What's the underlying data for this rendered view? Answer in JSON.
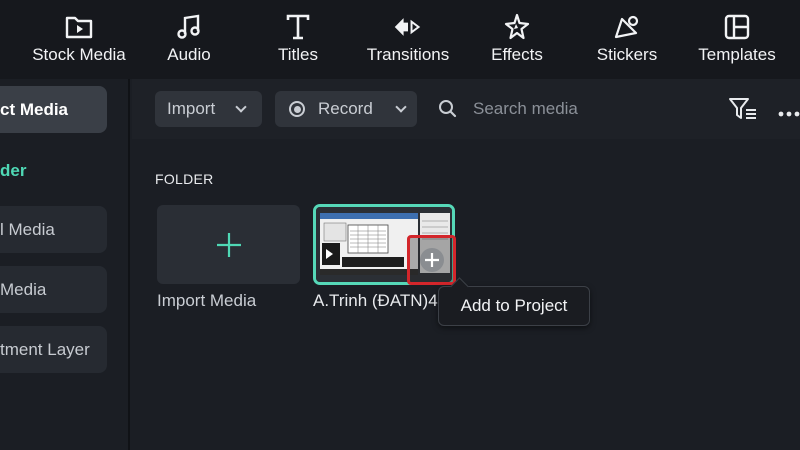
{
  "toolbar": {
    "items": [
      {
        "label": "Stock Media",
        "icon": "folder-play-icon"
      },
      {
        "label": "Audio",
        "icon": "music-note-icon"
      },
      {
        "label": "Titles",
        "icon": "text-t-icon"
      },
      {
        "label": "Transitions",
        "icon": "transitions-icon"
      },
      {
        "label": "Effects",
        "icon": "effects-sparkle-icon"
      },
      {
        "label": "Stickers",
        "icon": "sticker-icon"
      },
      {
        "label": "Templates",
        "icon": "templates-grid-icon"
      }
    ]
  },
  "left_panel": {
    "items": [
      {
        "label": "ct Media",
        "active": true
      },
      {
        "label": "l Media",
        "active": false
      },
      {
        "label": " Media",
        "active": false
      },
      {
        "label": "tment Layer",
        "active": false
      }
    ],
    "folder_label": "der"
  },
  "search_bar": {
    "import_label": "Import",
    "record_label": "Record",
    "search_placeholder": "Search media"
  },
  "content": {
    "folder_heading": "FOLDER",
    "import_tile_label": "Import Media",
    "media_item_label": "A.Trinh  (ĐATN)4",
    "tooltip": "Add to Project"
  },
  "colors": {
    "accent": "#4fd8b5",
    "highlight_border": "#d3262b"
  }
}
